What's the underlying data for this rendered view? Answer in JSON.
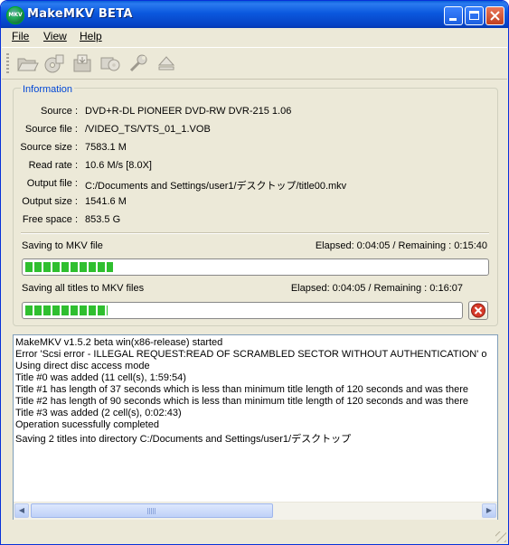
{
  "window": {
    "title": "MakeMKV BETA",
    "icon_text": "MKV"
  },
  "menu": [
    {
      "label": "File"
    },
    {
      "label": "View"
    },
    {
      "label": "Help"
    }
  ],
  "toolbar": {
    "icons": [
      "open-files-icon",
      "open-disc-icon",
      "save-mkv-icon",
      "backup-icon",
      "preferences-icon",
      "eject-icon"
    ]
  },
  "info": {
    "legend": "Information",
    "source_label": "Source :",
    "source_value": "DVD+R-DL PIONEER DVD-RW  DVR-215 1.06",
    "source_file_label": "Source file :",
    "source_file_value": "/VIDEO_TS/VTS_01_1.VOB",
    "source_size_label": "Source size :",
    "source_size_value": "7583.1 M",
    "read_rate_label": "Read rate :",
    "read_rate_value": "10.6 M/s [8.0X]",
    "output_file_label": "Output file :",
    "output_file_value": "C:/Documents and Settings/user1/デスクトップ/title00.mkv",
    "output_size_label": "Output size :",
    "output_size_value": "1541.6 M",
    "free_space_label": "Free space :",
    "free_space_value": "853.5 G"
  },
  "progress_current": {
    "label": "Saving to MKV file",
    "timing": "Elapsed: 0:04:05 / Remaining : 0:15:40",
    "fraction": 0.19
  },
  "progress_total": {
    "label": "Saving all titles to MKV files",
    "timing": "Elapsed: 0:04:05 / Remaining : 0:16:07",
    "fraction": 0.19
  },
  "log": [
    "MakeMKV v1.5.2 beta win(x86-release) started",
    "Error 'Scsi error - ILLEGAL REQUEST:READ OF SCRAMBLED SECTOR WITHOUT AUTHENTICATION' o",
    "Using direct disc access mode",
    "Title #0 was added (11 cell(s), 1:59:54)",
    "Title #1 has length of 37 seconds which is less than minimum title length of 120 seconds and was there",
    "Title #2 has length of 90 seconds which is less than minimum title length of 120 seconds and was there",
    "Title #3 was added (2 cell(s), 0:02:43)",
    "Operation sucessfully completed",
    "Saving 2 titles into directory C:/Documents and Settings/user1/デスクトップ"
  ],
  "colors": {
    "progress_green": "#2fbf2f",
    "titlebar_blue": "#0b58de",
    "legend_blue": "#0046d5"
  }
}
